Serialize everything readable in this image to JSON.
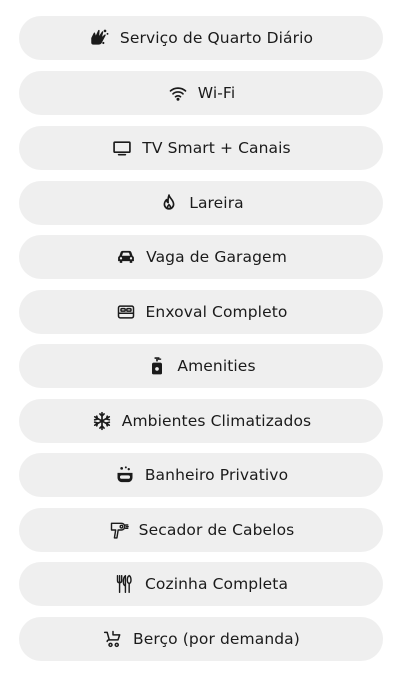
{
  "amenities": [
    {
      "label": "Serviço de Quarto Diário",
      "icon": "hand-wash-icon"
    },
    {
      "label": "Wi-Fi",
      "icon": "wifi-icon"
    },
    {
      "label": "TV Smart + Canais",
      "icon": "tv-icon"
    },
    {
      "label": "Lareira",
      "icon": "fire-icon"
    },
    {
      "label": "Vaga de Garagem",
      "icon": "car-icon"
    },
    {
      "label": "Enxoval Completo",
      "icon": "bed-icon"
    },
    {
      "label": "Amenities",
      "icon": "pump-bottle-icon"
    },
    {
      "label": "Ambientes Climatizados",
      "icon": "snowflake-icon"
    },
    {
      "label": "Banheiro Privativo",
      "icon": "bathtub-icon"
    },
    {
      "label": "Secador de Cabelos",
      "icon": "hair-dryer-icon"
    },
    {
      "label": "Cozinha Completa",
      "icon": "cutlery-icon"
    },
    {
      "label": "Berço (por demanda)",
      "icon": "baby-stroller-icon"
    }
  ]
}
